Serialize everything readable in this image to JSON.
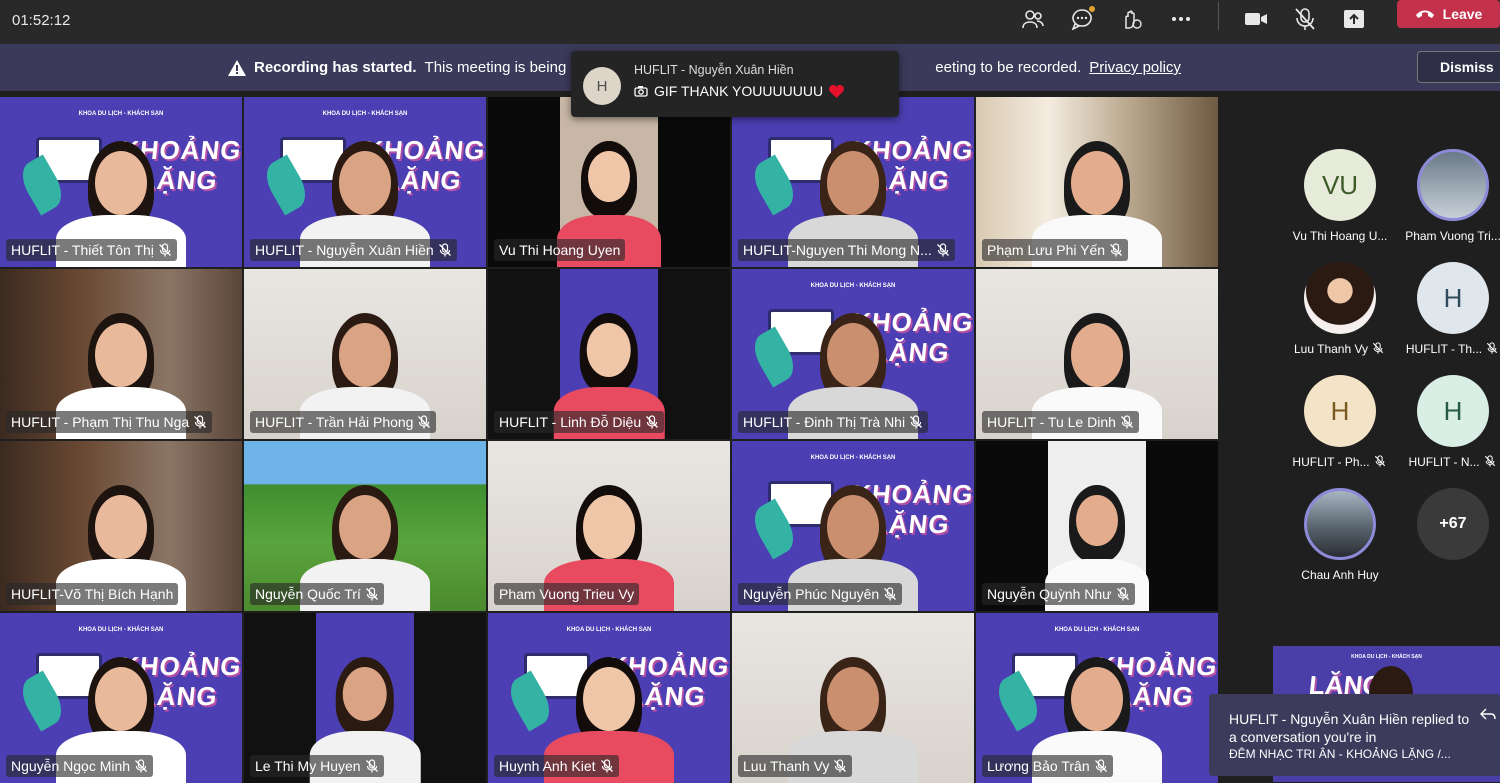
{
  "topbar": {
    "timer": "01:52:12",
    "leave_label": "Leave",
    "icons": [
      "people-icon",
      "chat-icon",
      "reactions-icon",
      "more-icon",
      "camera-icon",
      "mic-off-icon",
      "share-icon"
    ]
  },
  "banner": {
    "title": "Recording has started.",
    "message_part1": "This meeting is being rec",
    "message_part2": "eeting to be recorded.",
    "privacy_link": "Privacy policy",
    "dismiss_label": "Dismiss"
  },
  "toast": {
    "avatar_initial": "H",
    "sender": "HUFLIT - Nguyễn Xuân Hiền",
    "message": "GIF THANK YOUUUUUUU"
  },
  "grid": [
    {
      "name": "HUFLIT - Thiết Tôn Thị",
      "bg": "poster",
      "muted": true
    },
    {
      "name": "HUFLIT - Nguyễn Xuân Hiền",
      "bg": "poster",
      "muted": true
    },
    {
      "name": "Vu Thi Hoang Uyen",
      "bg": "portrait",
      "muted": false
    },
    {
      "name": "HUFLIT-Nguyen Thi Mong N...",
      "bg": "poster",
      "muted": true
    },
    {
      "name": "Phạm Lưu Phi Yến",
      "bg": "columns",
      "muted": true
    },
    {
      "name": "HUFLIT - Phạm Thị Thu Nga",
      "bg": "room",
      "muted": true
    },
    {
      "name": "HUFLIT - Trần Hải Phong",
      "bg": "wall",
      "muted": true
    },
    {
      "name": "HUFLIT - Linh Đỗ Diệu",
      "bg": "poster-narrow",
      "muted": true
    },
    {
      "name": "HUFLIT - Đinh Thị Trà Nhi",
      "bg": "poster",
      "muted": true
    },
    {
      "name": "HUFLIT - Tu Le Dinh",
      "bg": "wall",
      "muted": true
    },
    {
      "name": "HUFLIT-Võ Thị Bích Hạnh",
      "bg": "room",
      "muted": false
    },
    {
      "name": "Nguyễn Quốc Trí",
      "bg": "game",
      "muted": true
    },
    {
      "name": "Pham Vuong Trieu Vy",
      "bg": "wall",
      "muted": false
    },
    {
      "name": "Nguyễn Phúc Nguyên",
      "bg": "poster",
      "muted": true
    },
    {
      "name": "Nguyễn Quỳnh Như",
      "bg": "portrait-white",
      "muted": true
    },
    {
      "name": "Nguyễn Ngọc Minh",
      "bg": "poster",
      "muted": true
    },
    {
      "name": "Le Thi My Huyen",
      "bg": "poster-narrow",
      "muted": true
    },
    {
      "name": "Huynh Anh Kiet",
      "bg": "poster",
      "muted": true
    },
    {
      "name": "Luu Thanh Vy",
      "bg": "wall",
      "muted": true
    },
    {
      "name": "Lương Bảo Trân",
      "bg": "poster",
      "muted": true
    }
  ],
  "poster": {
    "header": "KHOA DU LỊCH - KHÁCH SẠN",
    "title1": "KHOẢNG",
    "title2": "LẶNG"
  },
  "participants": [
    {
      "label": "Vu Thi Hoang U...",
      "initials": "VU",
      "type": "initials",
      "color": "#e6ecd9",
      "text_color": "#3d5b2a",
      "muted": false
    },
    {
      "label": "Pham Vuong Tri...",
      "initials": "",
      "type": "photo-ring",
      "muted": false
    },
    {
      "label": "Luu Thanh Vy",
      "initials": "",
      "type": "photo",
      "muted": true
    },
    {
      "label": "HUFLIT - Th...",
      "initials": "H",
      "type": "initials",
      "color": "#dfe6ec",
      "text_color": "#2f4a5a",
      "muted": true
    },
    {
      "label": "HUFLIT - Ph...",
      "initials": "H",
      "type": "initials",
      "color": "#f4e4c7",
      "text_color": "#7a5a1e",
      "muted": true
    },
    {
      "label": "HUFLIT - N...",
      "initials": "H",
      "type": "initials",
      "color": "#d9eee4",
      "text_color": "#285b45",
      "muted": true
    },
    {
      "label": "Chau Anh Huy",
      "initials": "",
      "type": "photo-ring2",
      "muted": false
    },
    {
      "label": "",
      "initials": "+67",
      "type": "more",
      "muted": false
    }
  ],
  "chat_toast": {
    "line1": "HUFLIT - Nguyễn Xuân Hiền replied to a conversation you're in",
    "line2": "ĐÊM NHẠC TRI ÂN - KHOẢNG LẶNG /..."
  },
  "colors": {
    "poster_bg": "#4b3fb3",
    "leave": "#c4314b",
    "banner": "#3b3a5a"
  }
}
